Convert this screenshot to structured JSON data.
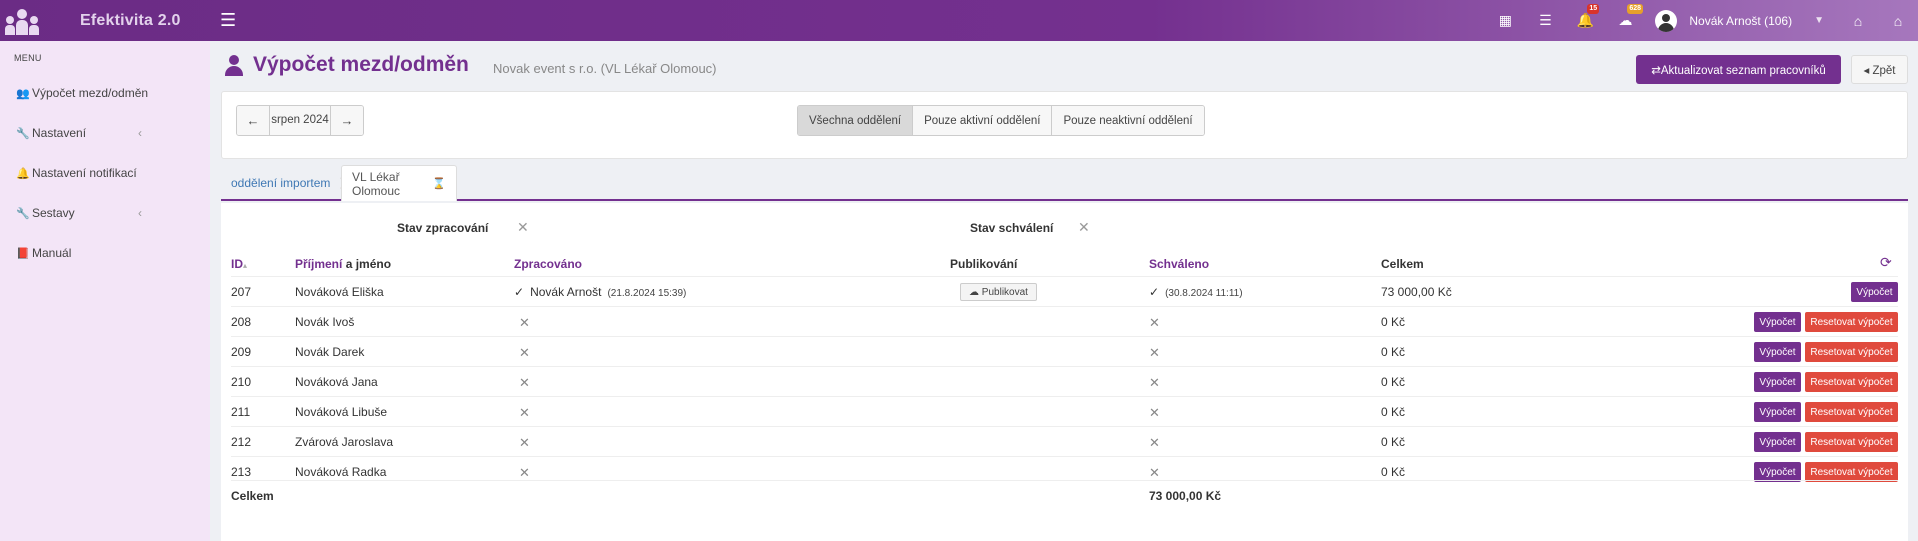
{
  "app": {
    "name": "Efektivita 2.0"
  },
  "topbar": {
    "icons": [
      {
        "name": "calendar-icon",
        "glyph": "▦"
      },
      {
        "name": "tasks-icon",
        "glyph": "☰"
      },
      {
        "name": "bell-icon",
        "glyph": "🔔",
        "badge": "15"
      },
      {
        "name": "messages-icon",
        "glyph": "☁",
        "badge": "628"
      }
    ],
    "user": "Novák Arnošt (106)",
    "bank_icon": "⌂",
    "home_icon": "⌂"
  },
  "sidebar": {
    "menu_label": "MENU",
    "items": [
      {
        "label": "Výpočet mezd/odměn",
        "icon": "👥",
        "has_chevron": false
      },
      {
        "label": "Nastavení",
        "icon": "🔧",
        "has_chevron": true
      },
      {
        "label": "Nastavení notifikací",
        "icon": "🔔",
        "has_chevron": false
      },
      {
        "label": "Sestavy",
        "icon": "🔧",
        "has_chevron": true
      },
      {
        "label": "Manuál",
        "icon": "📕",
        "has_chevron": false
      }
    ]
  },
  "header": {
    "title": "Výpočet mezd/odměn",
    "subtitle": "Novak event s r.o. (VL Lékař Olomouc)",
    "update_button": "⇄Aktualizovat seznam pracovníků",
    "back_button": "◂ Zpět"
  },
  "period": {
    "prev": "←",
    "month": "srpen 2024",
    "next": "→"
  },
  "filters": [
    "Všechna oddělení",
    "Pouze aktivní oddělení",
    "Pouze neaktivní oddělení"
  ],
  "tabs": [
    {
      "label": "oddělení importem",
      "icon": "⌛"
    },
    {
      "label": "VL Lékař Olomouc",
      "icon": "⌛"
    }
  ],
  "filter_labels": {
    "processing": "Stav zpracování",
    "approval": "Stav schválení",
    "clear": "✕"
  },
  "table": {
    "headers": {
      "id": "ID",
      "sort": "▴",
      "surname": "Příjmení",
      "name_rest": " a jméno",
      "processed": "Zpracováno",
      "published": "Publikování",
      "approved": "Schváleno",
      "total": "Celkem",
      "refresh": "⟳"
    },
    "rows": [
      {
        "id": "207",
        "name": "Nováková Eliška",
        "processed_by": "Novák Arnošt",
        "processed_date": "(21.8.2024 15:39)",
        "publish": "☁ Publikovat",
        "approved_date": "(30.8.2024 11:11)",
        "total": "73 000,00 Kč",
        "calc": "Výpočet"
      },
      {
        "id": "208",
        "name": "Novák Ivoš",
        "total": "0 Kč",
        "calc": "Výpočet",
        "reset": "Resetovat výpočet"
      },
      {
        "id": "209",
        "name": "Novák Darek",
        "total": "0 Kč",
        "calc": "Výpočet",
        "reset": "Resetovat výpočet"
      },
      {
        "id": "210",
        "name": "Nováková Jana",
        "total": "0 Kč",
        "calc": "Výpočet",
        "reset": "Resetovat výpočet"
      },
      {
        "id": "211",
        "name": "Nováková Libuše",
        "total": "0 Kč",
        "calc": "Výpočet",
        "reset": "Resetovat výpočet"
      },
      {
        "id": "212",
        "name": "Zvárová Jaroslava",
        "total": "0 Kč",
        "calc": "Výpočet",
        "reset": "Resetovat výpočet"
      },
      {
        "id": "213",
        "name": "Nováková Radka",
        "total": "0 Kč",
        "calc": "Výpočet",
        "reset": "Resetovat výpočet"
      }
    ],
    "total_label": "Celkem",
    "total_value": "73 000,00 Kč",
    "check_glyph": "✓",
    "x_glyph": "✕"
  },
  "colors": {
    "brand": "#73308f",
    "danger": "#e04a3d",
    "link": "#3f78b4"
  }
}
